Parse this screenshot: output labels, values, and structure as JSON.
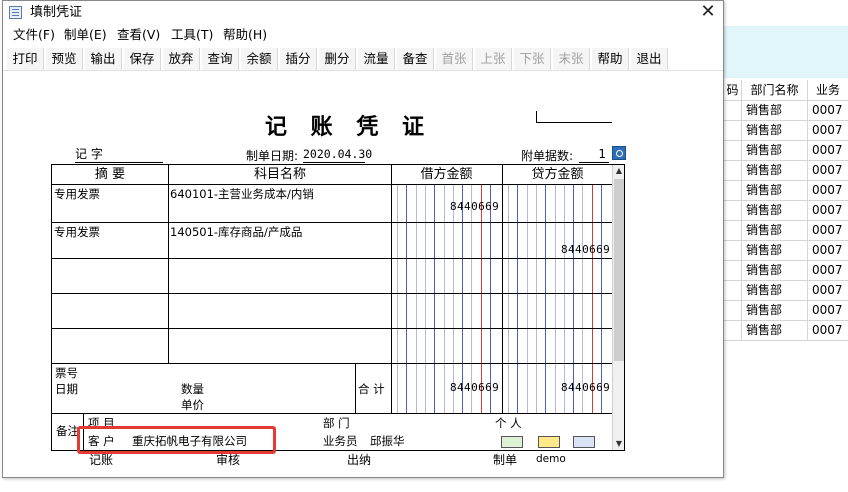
{
  "window": {
    "title": "填制凭证",
    "close_glyph": "✕"
  },
  "menu": [
    "文件(F)",
    "制单(E)",
    "查看(V)",
    "工具(T)",
    "帮助(H)"
  ],
  "toolbar": [
    {
      "label": "打印",
      "enabled": true
    },
    {
      "label": "预览",
      "enabled": true
    },
    {
      "label": "输出",
      "enabled": true
    },
    {
      "label": "保存",
      "enabled": true
    },
    {
      "label": "放弃",
      "enabled": true
    },
    {
      "label": "查询",
      "enabled": true
    },
    {
      "label": "余额",
      "enabled": true
    },
    {
      "label": "插分",
      "enabled": true
    },
    {
      "label": "删分",
      "enabled": true
    },
    {
      "label": "流量",
      "enabled": true
    },
    {
      "label": "备查",
      "enabled": true
    },
    {
      "label": "首张",
      "enabled": false
    },
    {
      "label": "上张",
      "enabled": false
    },
    {
      "label": "下张",
      "enabled": false
    },
    {
      "label": "末张",
      "enabled": false
    },
    {
      "label": "帮助",
      "enabled": true
    },
    {
      "label": "退出",
      "enabled": true
    }
  ],
  "voucher": {
    "title": "记 账 凭 证",
    "word": "记    字",
    "date_label": "制单日期:",
    "date": "2020.04.30",
    "attach_label": "附单据数:",
    "attach_count": "1",
    "headers": {
      "summary": "摘 要",
      "account": "科目名称",
      "debit": "借方金额",
      "credit": "贷方金额"
    },
    "rows": [
      {
        "summary": "专用发票",
        "account": "640101-主营业务成本/内销",
        "debit": "8440669",
        "credit": ""
      },
      {
        "summary": "专用发票",
        "account": "140501-库存商品/产成品",
        "debit": "",
        "credit": "8440669"
      },
      {
        "summary": "",
        "account": "",
        "debit": "",
        "credit": ""
      },
      {
        "summary": "",
        "account": "",
        "debit": "",
        "credit": ""
      },
      {
        "summary": "",
        "account": "",
        "debit": "",
        "credit": ""
      }
    ],
    "footer": {
      "ticket_no_label": "票号",
      "date_label": "日期",
      "qty_label": "数量",
      "price_label": "单价",
      "total_label": "合 计",
      "total_debit": "8440669",
      "total_credit": "8440669"
    },
    "remarks": {
      "label": "备注",
      "project_label": "项  目",
      "dept_label": "部  门",
      "person_label": "个  人",
      "customer_label": "客  户",
      "customer_value": "重庆拓帆电子有限公司",
      "salesman_label": "业务员",
      "salesman_value": "邱振华"
    },
    "signatures": {
      "bookkeeper": "记账",
      "auditor": "审核",
      "cashier": "出纳",
      "maker_label": "制单",
      "maker": "demo"
    }
  },
  "background_table": {
    "headers": [
      "码",
      "部门名称",
      "业务"
    ],
    "rows": [
      [
        "销售部",
        "0007"
      ],
      [
        "销售部",
        "0007"
      ],
      [
        "销售部",
        "0007"
      ],
      [
        "销售部",
        "0007"
      ],
      [
        "销售部",
        "0007"
      ],
      [
        "销售部",
        "0007"
      ],
      [
        "销售部",
        "0007"
      ],
      [
        "销售部",
        "0007"
      ],
      [
        "销售部",
        "0007"
      ],
      [
        "销售部",
        "0007"
      ],
      [
        "销售部",
        "0007"
      ],
      [
        "销售部",
        "0007"
      ]
    ]
  }
}
